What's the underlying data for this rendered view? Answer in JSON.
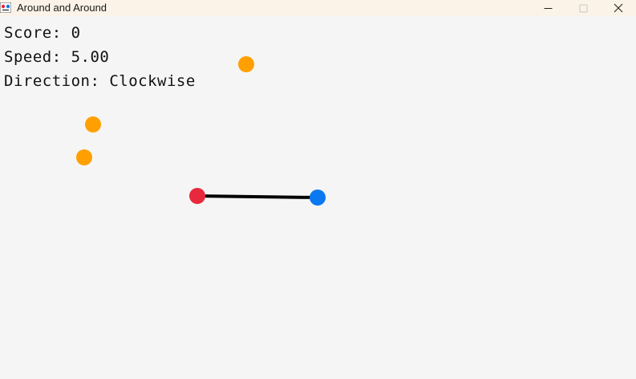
{
  "window": {
    "title": "Around and Around",
    "minimize_icon": "minimize-icon",
    "maximize_icon": "maximize-icon",
    "close_icon": "close-icon"
  },
  "hud": {
    "score_label": "Score:",
    "score_value": "0",
    "speed_label": "Speed:",
    "speed_value": "5.00",
    "direction_label": "Direction:",
    "direction_value": "Clockwise"
  },
  "colors": {
    "background": "#f5f5f5",
    "titlebar": "#fbf3e7",
    "red_ball": "#e8283c",
    "blue_ball": "#0a78f0",
    "orange_dot": "#ffa000",
    "rod": "#000000"
  }
}
